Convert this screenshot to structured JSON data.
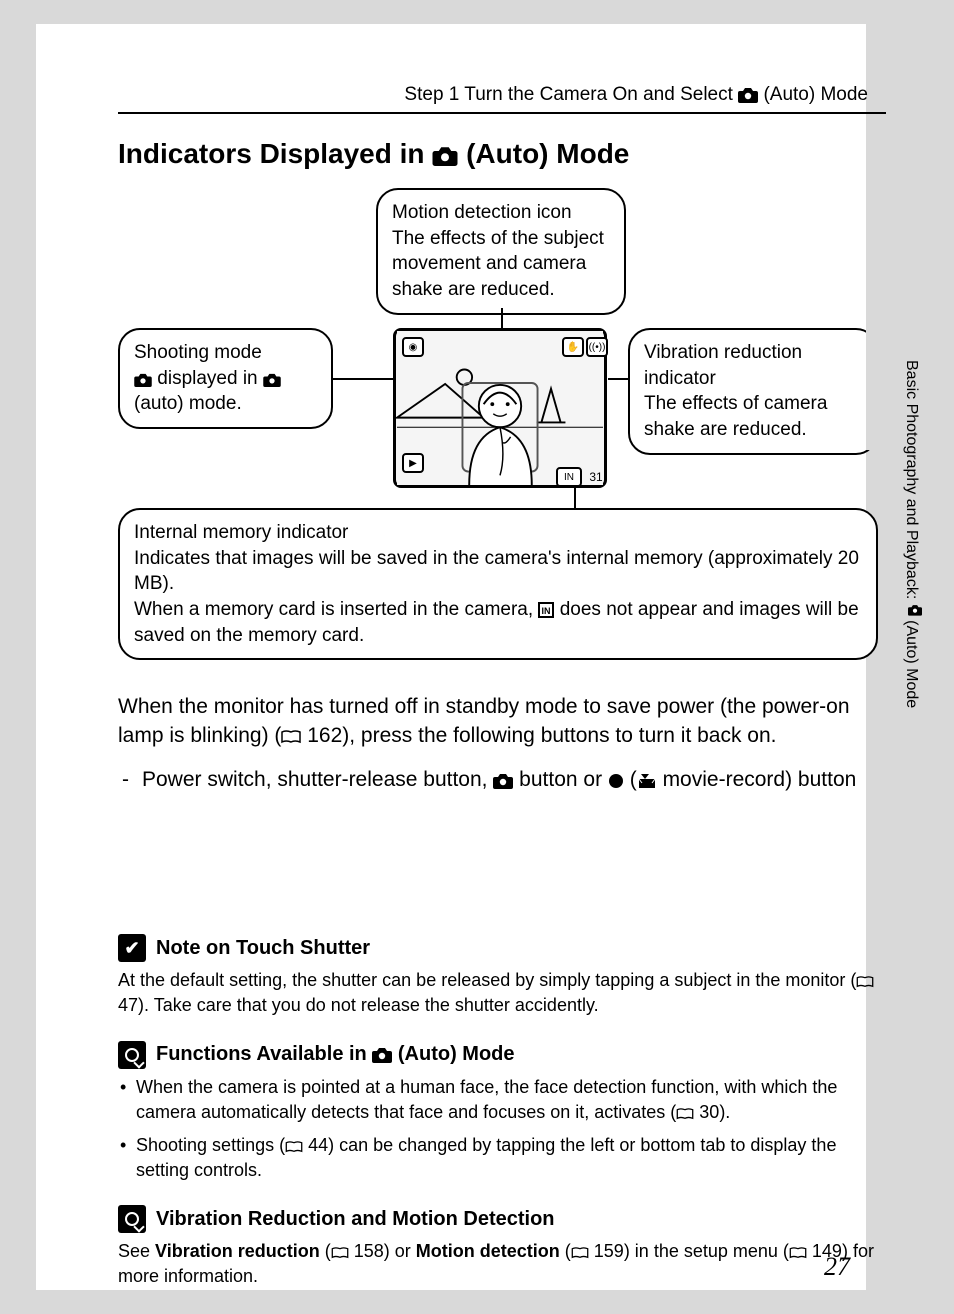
{
  "header": {
    "breadcrumb_pre": "Step 1 Turn the Camera On and Select ",
    "breadcrumb_post": " (Auto) Mode"
  },
  "title": {
    "pre": "Indicators Displayed in ",
    "post": " (Auto) Mode"
  },
  "callouts": {
    "motion": "Motion detection icon\nThe effects of the subject movement and camera shake are reduced.",
    "shoot_l1": "Shooting mode",
    "shoot_l2_pre": " displayed in ",
    "shoot_l2_post": " (auto) mode.",
    "vr": "Vibration reduction indicator\nThe effects of camera shake are reduced.",
    "mem_l1": "Internal memory indicator",
    "mem_l2": "Indicates that images will be saved in the camera's internal memory (approximately 20 MB).",
    "mem_l3_pre": "When a memory card is inserted in the camera, ",
    "mem_l3_post": " does not appear and images will be saved on the memory card."
  },
  "screen_chip_count": "31",
  "body": {
    "p1_pre": "When the monitor has turned off in standby mode to save power (the power-on lamp is blinking) (",
    "p1_ref": " 162",
    "p1_post": "), press the following buttons to turn it back on.",
    "bullet_pre": "Power switch, shutter-release button, ",
    "bullet_mid": " button or ",
    "bullet_paren_open": " (",
    "bullet_paren_close": " movie-record) button"
  },
  "notes": {
    "n1_title": "Note on Touch Shutter",
    "n1_body_pre": "At the default setting, the shutter can be released by simply tapping a subject in the monitor (",
    "n1_body_ref": " 47",
    "n1_body_post": "). Take care that you do not release the shutter accidently.",
    "n2_title_pre": "Functions Available in ",
    "n2_title_post": " (Auto) Mode",
    "n2_b1_pre": "When the camera is pointed at a human face, the face detection function, with which the camera automatically detects that face and focuses on it, activates (",
    "n2_b1_ref": " 30",
    "n2_b1_post": ").",
    "n2_b2_pre": "Shooting settings (",
    "n2_b2_ref": " 44",
    "n2_b2_post": ") can be changed by tapping the left or bottom tab to display the setting controls.",
    "n3_title": "Vibration Reduction and Motion Detection",
    "n3_body_pre": "See ",
    "n3_vr": "Vibration reduction",
    "n3_vr_ref": " 158",
    "n3_mid": ") or ",
    "n3_md": "Motion detection",
    "n3_md_ref": " 159",
    "n3_mid2": ") in the setup menu (",
    "n3_setup_ref": " 149",
    "n3_post": ") for more information."
  },
  "sidebar": {
    "text_pre": "Basic Photography and Playback: ",
    "text_post": " (Auto) Mode"
  },
  "page_number": "27"
}
